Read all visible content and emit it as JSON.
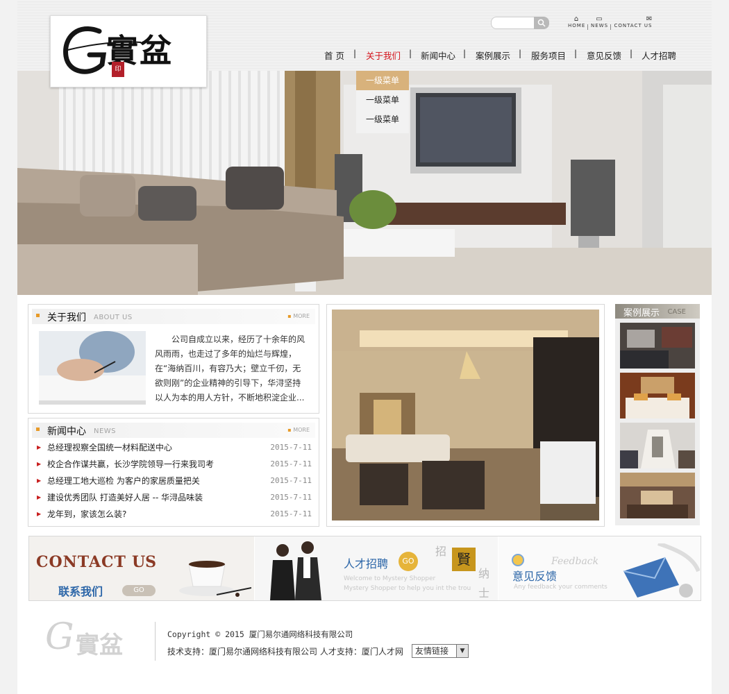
{
  "brand": {
    "logo_g": "G",
    "logo_cn": "實盆",
    "seal": "印"
  },
  "search": {
    "placeholder": "",
    "button_icon": "search-icon"
  },
  "toplinks": [
    {
      "label": "HOME",
      "icon": "home-icon"
    },
    {
      "label": "NEWS",
      "icon": "news-icon"
    },
    {
      "label": "CONTACT US",
      "icon": "mail-icon"
    }
  ],
  "nav": {
    "items": [
      "首 页",
      "关于我们",
      "新闻中心",
      "案例展示",
      "服务项目",
      "意见反馈",
      "人才招聘"
    ],
    "active_index": 1,
    "separator": "|"
  },
  "dropdown": {
    "items": [
      "一级菜单",
      "一级菜单",
      "一级菜单"
    ],
    "active_index": 0
  },
  "about": {
    "title": "关于我们",
    "subtitle": "ABOUT US",
    "more": "MORE",
    "text": "公司自成立以来，经历了十余年的风风雨雨，也走过了多年的灿烂与辉煌，在“海纳百川，有容乃大；壁立千仞，无欲则刚”的企业精神的引导下，华浔坚持以人为本的用人方针，不断地积淀企业..."
  },
  "news": {
    "title": "新闻中心",
    "subtitle": "NEWS",
    "more": "MORE",
    "items": [
      {
        "title": "总经理视察全国统一材料配送中心",
        "date": "2015-7-11"
      },
      {
        "title": "校企合作谋共赢，长沙学院领导一行来我司考",
        "date": "2015-7-11"
      },
      {
        "title": "总经理工地大巡检 为客户的家居质量把关",
        "date": "2015-7-11"
      },
      {
        "title": "建设优秀团队 打造美好人居 -- 华浔品味装",
        "date": "2015-7-11"
      },
      {
        "title": "龙年到，家该怎么装?",
        "date": "2015-7-11"
      }
    ]
  },
  "cases": {
    "title": "案例展示",
    "subtitle": "CASE"
  },
  "ads": {
    "contact": {
      "en1": "CONTACT",
      "en2": "US",
      "cn": "联系我们",
      "go": "GO"
    },
    "jobs": {
      "title": "人才招聘",
      "go": "GO",
      "line1": "Welcome to Mystery Shopper",
      "line2": "Mystery Shopper to help you int the trou",
      "c1": "招",
      "c2": "賢",
      "c3": "纳",
      "c4": "士"
    },
    "feedback": {
      "en": "Feedback",
      "cn": "意见反馈",
      "line": "Any feedback your comments"
    }
  },
  "footer": {
    "copyright_prefix": "Copyright © 2015",
    "company": "厦门易尔通网络科技有限公司",
    "support": "技术支持：厦门易尔通网络科技有限公司 人才支持：厦门人才网",
    "friend_links": "友情链接"
  }
}
